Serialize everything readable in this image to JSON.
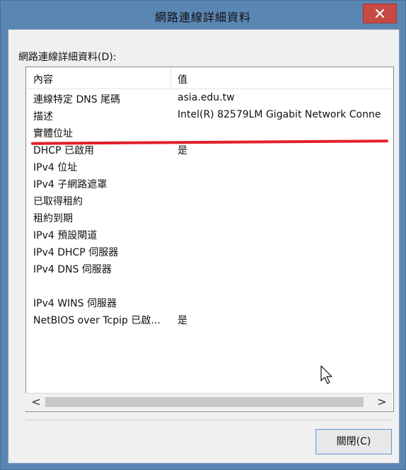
{
  "window": {
    "title": "網路連線詳細資料",
    "close_icon": "close-icon",
    "accent_color": "#5a86b3",
    "close_color": "#c74a44"
  },
  "list": {
    "label": "網路連線詳細資料(D):",
    "columns": [
      "內容",
      "值"
    ],
    "rows": [
      {
        "property": "連線特定 DNS 尾碼",
        "value": "asia.edu.tw"
      },
      {
        "property": "描述",
        "value": "Intel(R) 82579LM Gigabit Network Conne"
      },
      {
        "property": "實體位址",
        "value": ""
      },
      {
        "property": "DHCP 已啟用",
        "value": "是"
      },
      {
        "property": "IPv4 位址",
        "value": ""
      },
      {
        "property": "IPv4 子網路遮罩",
        "value": ""
      },
      {
        "property": "已取得租約",
        "value": ""
      },
      {
        "property": "租約到期",
        "value": ""
      },
      {
        "property": "IPv4 預設閘道",
        "value": ""
      },
      {
        "property": "IPv4 DHCP 伺服器",
        "value": ""
      },
      {
        "property": "IPv4 DNS 伺服器",
        "value": ""
      },
      {
        "property": "",
        "value": ""
      },
      {
        "property": "IPv4 WINS 伺服器",
        "value": ""
      },
      {
        "property": "NetBIOS over Tcpip 已啟...",
        "value": "是"
      }
    ]
  },
  "scrollbar": {
    "left_icon": "chevron-left-icon",
    "right_icon": "chevron-right-icon",
    "left_glyph": "<",
    "right_glyph": ">"
  },
  "footer": {
    "close_label": "關閉(C)"
  },
  "annotation_color": "#e0202a"
}
